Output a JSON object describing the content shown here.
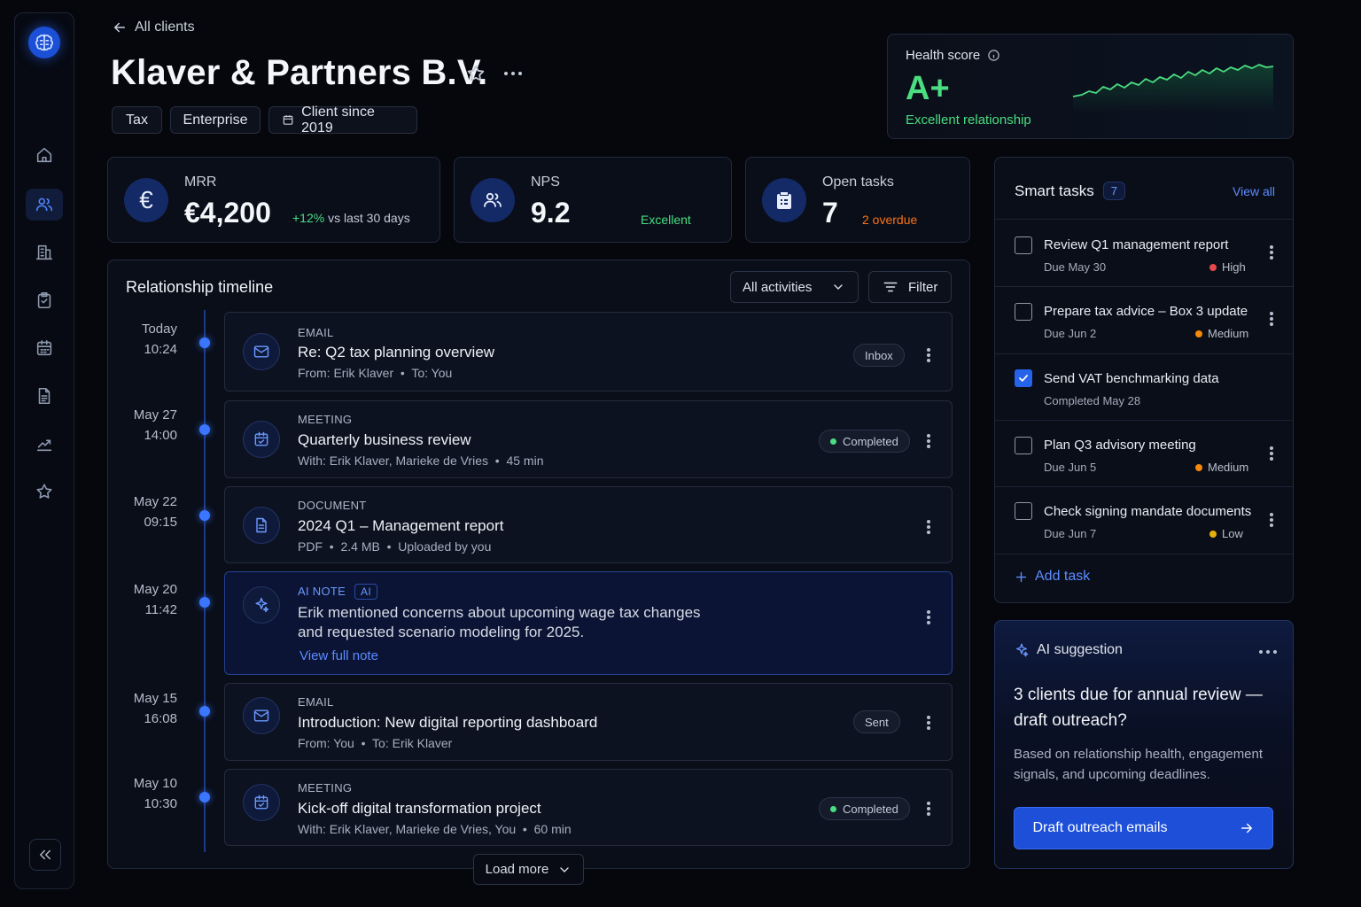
{
  "nav": {
    "back_label": "All clients",
    "collapse_icon": "collapse-icon"
  },
  "client": {
    "name": "Klaver & Partners B.V.",
    "tags": [
      "Tax",
      "Enterprise",
      "Client since 2019"
    ]
  },
  "health": {
    "label": "Health score",
    "grade": "A+",
    "summary": "Excellent relationship"
  },
  "stats": {
    "mrr": {
      "label": "MRR",
      "value": "€4,200",
      "change": "+12%",
      "change_suffix": "vs last 30 days"
    },
    "nps": {
      "label": "NPS",
      "value": "9.2",
      "note": "Excellent"
    },
    "tasks": {
      "label": "Open tasks",
      "value": "7",
      "note": "2 overdue"
    }
  },
  "timeline": {
    "title": "Relationship timeline",
    "filter_select": "All activities",
    "filter_button": "Filter",
    "load_more": "Load more",
    "items": [
      {
        "date": "Today",
        "time": "10:24",
        "type": "EMAIL",
        "title": "Re: Q2 tax planning overview",
        "meta1": "From: Erik Klaver",
        "meta2": "To: You",
        "badge": "Inbox"
      },
      {
        "date": "May 27",
        "time": "14:00",
        "type": "MEETING",
        "title": "Quarterly business review",
        "meta1": "With: Erik Klaver, Marieke de Vries",
        "meta2": "45 min",
        "badge": "Completed"
      },
      {
        "date": "May 22",
        "time": "09:15",
        "type": "DOCUMENT",
        "title": "2024 Q1 – Management report",
        "meta1": "PDF",
        "meta2": "2.4 MB",
        "meta3": "Uploaded by you"
      },
      {
        "date": "May 20",
        "time": "11:42",
        "type": "AI NOTE",
        "ai_badge": "AI",
        "line1": "Erik mentioned concerns about upcoming wage tax changes",
        "line2": "and requested scenario modeling for 2025.",
        "link": "View full note"
      },
      {
        "date": "May 15",
        "time": "16:08",
        "type": "EMAIL",
        "title": "Introduction: New digital reporting dashboard",
        "meta1": "From: You",
        "meta2": "To: Erik Klaver",
        "badge": "Sent"
      },
      {
        "date": "May 10",
        "time": "10:30",
        "type": "MEETING",
        "title": "Kick-off digital transformation project",
        "meta1": "With: Erik Klaver, Marieke de Vries, You",
        "meta2": "60 min",
        "badge": "Completed"
      }
    ]
  },
  "smart_tasks": {
    "title": "Smart tasks",
    "count": "7",
    "view_all": "View all",
    "add": "Add task",
    "items": [
      {
        "name": "Review Q1 management report",
        "due": "Due May 30",
        "priority": "High",
        "color": "#e5484d",
        "checked": false
      },
      {
        "name": "Prepare tax advice – Box 3 update",
        "due": "Due Jun 2",
        "priority": "Medium",
        "color": "#f5870a",
        "checked": false
      },
      {
        "name": "Send VAT benchmarking data",
        "due": "Completed May 28",
        "checked": true
      },
      {
        "name": "Plan Q3 advisory meeting",
        "due": "Due Jun 5",
        "priority": "Medium",
        "color": "#f5870a",
        "checked": false
      },
      {
        "name": "Check signing mandate documents",
        "due": "Due Jun 7",
        "priority": "Low",
        "color": "#e5b00a",
        "checked": false
      }
    ]
  },
  "ai_suggestion": {
    "label": "AI suggestion",
    "heading_line1": "3 clients due for annual review —",
    "heading_line2": "draft outreach?",
    "body_line1": "Based on relationship health, engagement",
    "body_line2": "signals, and upcoming deadlines.",
    "cta": "Draft outreach emails"
  },
  "colors": {
    "accent": "#3a76ff",
    "positive": "#4ade80",
    "warning": "#f97316",
    "background": "#05070d"
  }
}
